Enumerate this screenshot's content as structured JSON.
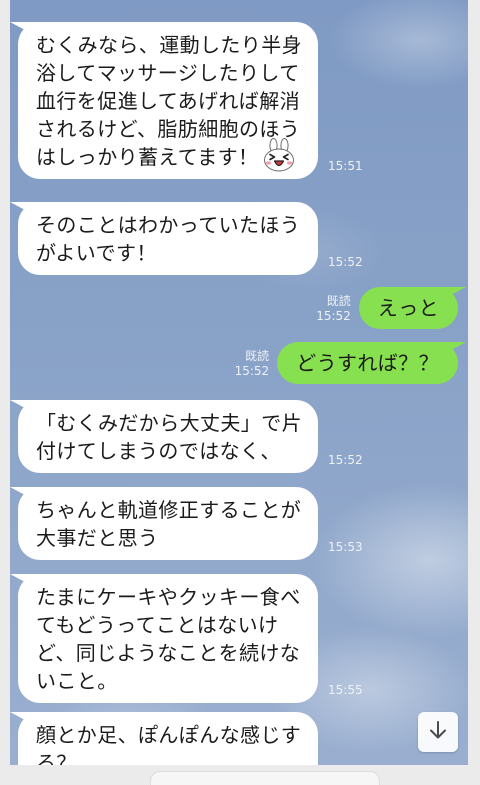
{
  "colors": {
    "chat_background": "#89a2c7",
    "incoming_bubble": "#ffffff",
    "outgoing_bubble": "#87e04f",
    "meta_text": "#eef2f8",
    "frame": "#ebebeb"
  },
  "messages": [
    {
      "outgoing": false,
      "lines": [
        "むくみなら、運動したり半身",
        "浴してマッサージしたりして",
        "血行を促進してあげれば解消",
        "されるけど、脂肪細胞のほう",
        "はしっかり蓄えてます！"
      ],
      "sticker": "cony-laughing-icon",
      "time": "15:51"
    },
    {
      "outgoing": false,
      "lines": [
        "そのことはわかっていたほう",
        "がよいです！"
      ],
      "time": "15:52"
    },
    {
      "outgoing": true,
      "lines": [
        "えっと"
      ],
      "read": "既読",
      "time": "15:52"
    },
    {
      "outgoing": true,
      "lines": [
        "どうすれば？？"
      ],
      "read": "既読",
      "time": "15:52"
    },
    {
      "outgoing": false,
      "lines": [
        "「むくみだから大丈夫」で片",
        "付けてしまうのではなく、"
      ],
      "time": "15:52"
    },
    {
      "outgoing": false,
      "lines": [
        "ちゃんと軌道修正することが",
        "大事だと思う"
      ],
      "time": "15:53"
    },
    {
      "outgoing": false,
      "lines": [
        "たまにケーキやクッキー食べ",
        "てもどうってことはないけ",
        "ど、同じようなことを続けな",
        "いこと。"
      ],
      "time": "15:55"
    },
    {
      "outgoing": false,
      "lines": [
        "顔とか足、ぽんぽんな感じす",
        "る？"
      ]
    }
  ],
  "scroll_to_bottom": {
    "icon": "arrow-down-icon"
  }
}
